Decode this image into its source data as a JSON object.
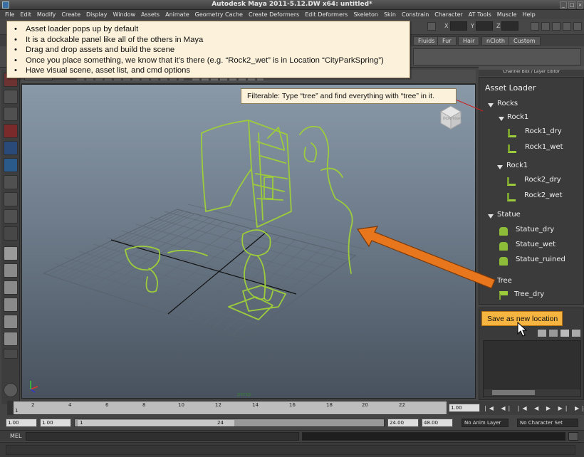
{
  "window": {
    "title": "Autodesk Maya 2011-5.12.DW x64: untitled*"
  },
  "menubar": {
    "items": [
      "File",
      "Edit",
      "Modify",
      "Create",
      "Display",
      "Window",
      "Assets",
      "Animate",
      "Geometry Cache",
      "Create Deformers",
      "Edit Deformers",
      "Skeleton",
      "Skin",
      "Constrain",
      "Character",
      "AT Tools",
      "Muscle",
      "Help"
    ]
  },
  "status": {
    "x_label": "X",
    "y_label": "Y",
    "z_label": "Z"
  },
  "shelf": {
    "tabs": [
      "Fluids",
      "Fur",
      "Hair",
      "nCloth",
      "Custom"
    ]
  },
  "notes": {
    "items": [
      "Asset loader pops up by default",
      "It is a dockable panel like all of the others in Maya",
      "Drag and drop assets and build the scene",
      "Once you place something, we know that it’s there (e.g. “Rock2_wet” is in Location “CityParkSpring”)",
      "Have visual scene, asset list, and cmd options"
    ]
  },
  "filter_note": "Filterable: Type “tree” and find everything with “tree” in it.",
  "right_panel": {
    "header": "Channel Box / Layer Editor",
    "asset_loader_title": "Asset Loader",
    "tree": {
      "rocks": "Rocks",
      "rock1_a": "Rock1",
      "rock1_dry": "Rock1_dry",
      "rock1_wet": "Rock1_wet",
      "rock1_b": "Rock1",
      "rock2_dry": "Rock2_dry",
      "rock2_wet": "Rock2_wet",
      "statue": "Statue",
      "statue_dry": "Statue_dry",
      "statue_wet": "Statue_wet",
      "statue_ruined": "Statue_ruined",
      "tree": "Tree",
      "tree_dry": "Tree_dry"
    },
    "save_button": "Save as new location"
  },
  "viewport": {
    "persp_label": "persp",
    "cube_front": "FRONT",
    "cube_right": "RIGHT"
  },
  "timeline": {
    "ticks": [
      "1",
      "2",
      "4",
      "6",
      "8",
      "10",
      "12",
      "14",
      "16",
      "18",
      "20",
      "22"
    ],
    "current_frame": "1.00",
    "range_start": "1.00",
    "range_start2": "1.00",
    "slider_start": "1",
    "slider_end": "24",
    "range_end": "24.00",
    "range_end2": "48.00",
    "anim_layer": "No Anim Layer",
    "char_set": "No Character Set"
  },
  "cmd": {
    "label": "MEL"
  },
  "colors": {
    "note_bg": "#fcf2dc",
    "button_orange": "#f6b440",
    "arrow_orange": "#e8761c",
    "sketch_green": "#9ccc3c"
  }
}
